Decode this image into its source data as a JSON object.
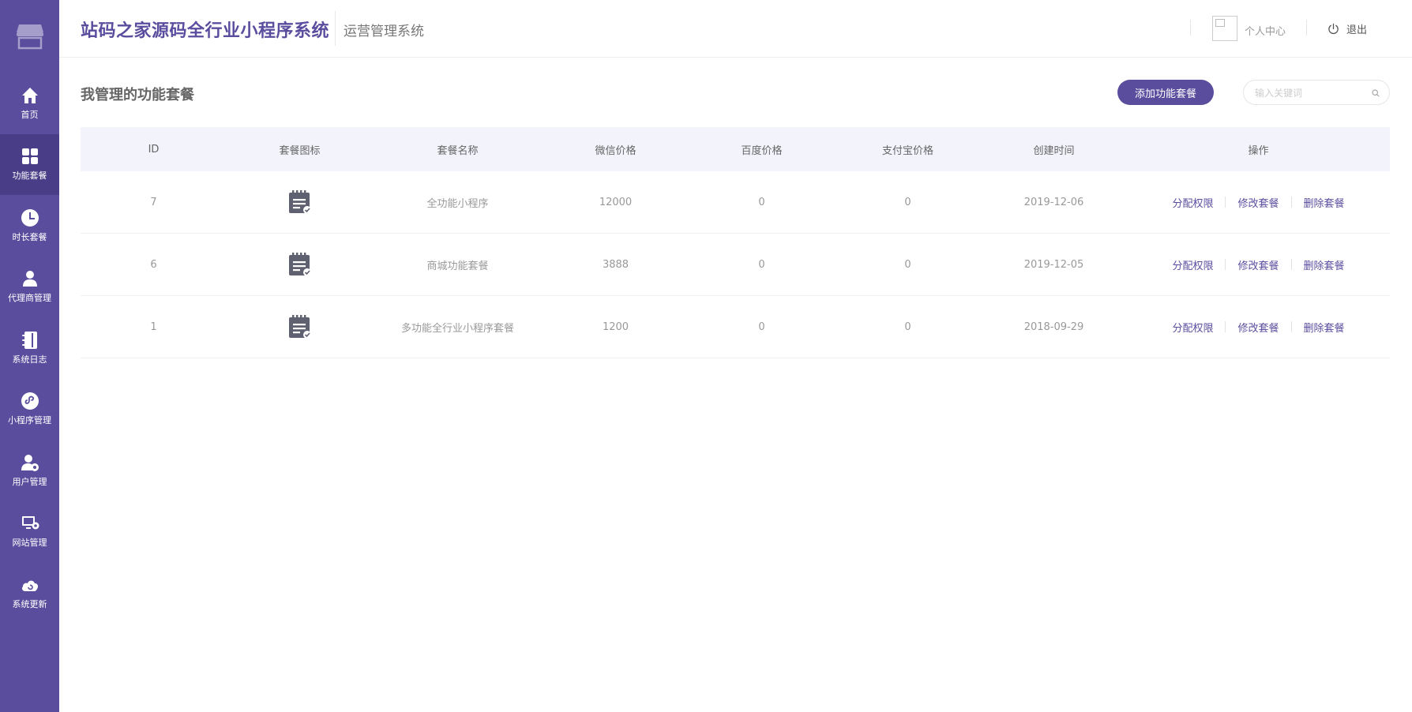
{
  "sidebar": {
    "logo_icon": "store-icon",
    "items": [
      {
        "label": "首页",
        "icon": "home-icon"
      },
      {
        "label": "功能套餐",
        "icon": "grid-icon",
        "active": true
      },
      {
        "label": "时长套餐",
        "icon": "clock-icon"
      },
      {
        "label": "代理商管理",
        "icon": "agent-icon"
      },
      {
        "label": "系统日志",
        "icon": "log-book-icon"
      },
      {
        "label": "小程序管理",
        "icon": "mini-program-icon"
      },
      {
        "label": "用户管理",
        "icon": "user-settings-icon"
      },
      {
        "label": "网站管理",
        "icon": "monitor-settings-icon"
      },
      {
        "label": "系统更新",
        "icon": "cloud-update-icon"
      }
    ]
  },
  "header": {
    "brand": "站码之家源码全行业小程序系统",
    "subtitle": "运营管理系统",
    "profile_label": "个人中心",
    "logout_label": "退出"
  },
  "main": {
    "page_title": "我管理的功能套餐",
    "add_button": "添加功能套餐",
    "search_placeholder": "输入关键词"
  },
  "table": {
    "columns": [
      "ID",
      "套餐图标",
      "套餐名称",
      "微信价格",
      "百度价格",
      "支付宝价格",
      "创建时间",
      "操作"
    ],
    "actions": [
      "分配权限",
      "修改套餐",
      "删除套餐"
    ],
    "rows": [
      {
        "id": "7",
        "name": "全功能小程序",
        "wechat_price": "12000",
        "baidu_price": "0",
        "alipay_price": "0",
        "created": "2019-12-06"
      },
      {
        "id": "6",
        "name": "商城功能套餐",
        "wechat_price": "3888",
        "baidu_price": "0",
        "alipay_price": "0",
        "created": "2019-12-05"
      },
      {
        "id": "1",
        "name": "多功能全行业小程序套餐",
        "wechat_price": "1200",
        "baidu_price": "0",
        "alipay_price": "0",
        "created": "2018-09-29"
      }
    ]
  },
  "colors": {
    "brand": "#5b4d9e",
    "sidebar_active": "#4a3d87",
    "table_header_bg": "#f2f3fb"
  }
}
